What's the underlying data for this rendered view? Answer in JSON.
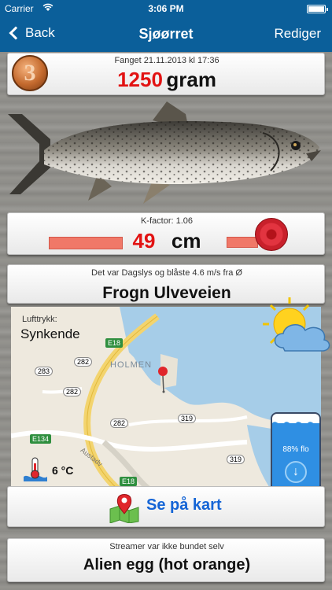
{
  "status": {
    "carrier": "Carrier",
    "time": "3:06 PM"
  },
  "nav": {
    "back_label": "Back",
    "title": "Sjøørret",
    "edit_label": "Rediger"
  },
  "catch": {
    "rank": "3",
    "caught_label": "Fanget 21.11.2013 kl 17:36",
    "weight_value": "1250",
    "weight_unit": "gram"
  },
  "length": {
    "kfactor_label": "K-factor: 1.06",
    "value": "49",
    "unit": "cm"
  },
  "location": {
    "weather_text": "Det var Dagslys og blåste 4.6 m/s fra Ø",
    "place": "Frogn Ulveveien"
  },
  "map": {
    "lufttrykk_label": "Lufttrykk:",
    "lufttrykk_value": "Synkende",
    "temperature": "6 °C",
    "area_label": "HOLMEN",
    "roads": [
      "E18",
      "283",
      "282",
      "282",
      "282",
      "319",
      "319",
      "E134",
      "E18"
    ],
    "street_label": "Austadv"
  },
  "tide": {
    "percent_label": "88% flo",
    "level": 0.88
  },
  "map_button": {
    "label": "Se på kart"
  },
  "lure": {
    "note": "Streamer var ikke bundet selv",
    "name": "Alien egg (hot orange)"
  },
  "colors": {
    "nav_bar": "#0b5f9a",
    "accent_red": "#e21212",
    "link_blue": "#1565d6"
  }
}
